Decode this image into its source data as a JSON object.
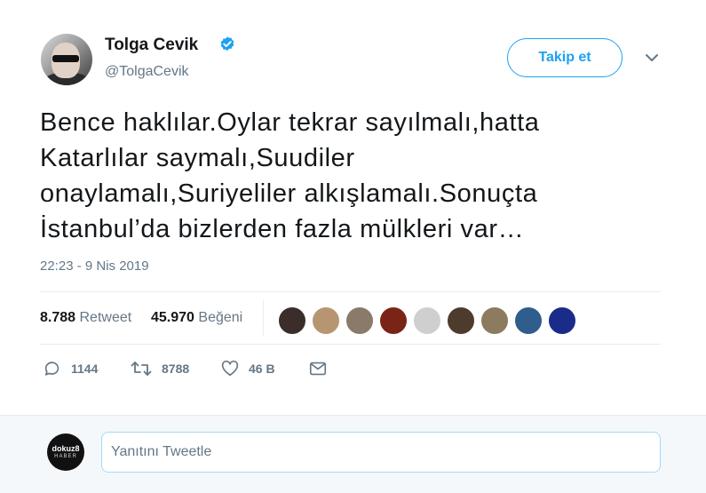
{
  "author": {
    "name": "Tolga Cevik",
    "handle": "@TolgaCevik",
    "verified_icon": "verified-badge-icon",
    "follow_label": "Takip et"
  },
  "tweet": {
    "text": "Bence haklılar.Oylar tekrar sayılmalı,hatta\nKatarlılar saymalı,Suudiler\nonaylamalı,Suriyeliler alkışlamalı.Sonuçta\nİstanbul’da bizlerden fazla mülkleri var…",
    "timestamp": "22:23 - 9 Nis 2019"
  },
  "stats": {
    "retweet_count": "8.788",
    "retweet_label": "Retweet",
    "like_count": "45.970",
    "like_label": "Beğeni"
  },
  "likers": [
    {
      "name": "liker-avatar-1",
      "color": "#3b2e2a"
    },
    {
      "name": "liker-avatar-2",
      "color": "#b89572"
    },
    {
      "name": "liker-avatar-3",
      "color": "#8a7a6a"
    },
    {
      "name": "liker-avatar-4",
      "color": "#7a2418"
    },
    {
      "name": "liker-avatar-5",
      "color": "#cfcfcf"
    },
    {
      "name": "liker-avatar-6",
      "color": "#4d3b2c"
    },
    {
      "name": "liker-avatar-7",
      "color": "#8c7b5e"
    },
    {
      "name": "liker-avatar-8",
      "color": "#2f5d8c"
    },
    {
      "name": "liker-avatar-9",
      "color": "#1a2b8a"
    }
  ],
  "actions": {
    "reply_count": "1144",
    "retweet_count": "8788",
    "like_count": "46 B"
  },
  "reply": {
    "avatar_line1": "dokuz8",
    "avatar_line2": "HABER",
    "placeholder": "Yanıtını Tweetle"
  },
  "colors": {
    "accent": "#1da1f2",
    "secondary_text": "#657786",
    "border": "#e6ecf0"
  }
}
